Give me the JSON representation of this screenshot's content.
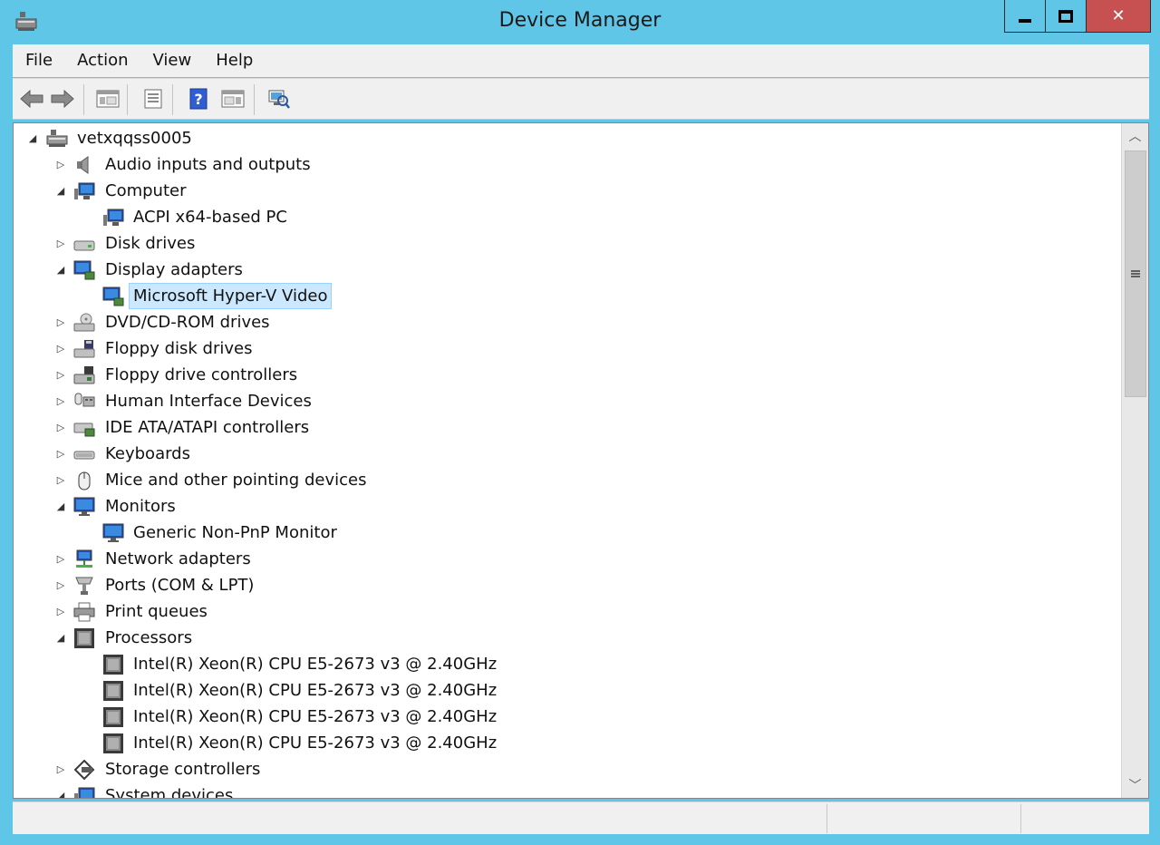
{
  "window": {
    "title": "Device Manager",
    "controls": {
      "minimize": "minimize",
      "maximize": "maximize",
      "close": "✕"
    }
  },
  "menu": [
    "File",
    "Action",
    "View",
    "Help"
  ],
  "toolbar": [
    {
      "name": "back-button",
      "icon": "back-arrow-icon"
    },
    {
      "name": "forward-button",
      "icon": "forward-arrow-icon"
    },
    {
      "name": "show-hide-console-tree-button",
      "icon": "console-tree-icon"
    },
    {
      "name": "properties-button",
      "icon": "properties-icon"
    },
    {
      "name": "help-button",
      "icon": "help-icon"
    },
    {
      "name": "show-action-pane-button",
      "icon": "action-pane-icon"
    },
    {
      "name": "scan-hardware-changes-button",
      "icon": "scan-hardware-icon"
    }
  ],
  "tree": {
    "root": "vetxqqss0005",
    "nodes": [
      {
        "label": "Audio inputs and outputs",
        "expanded": false,
        "icon": "speaker-icon"
      },
      {
        "label": "Computer",
        "expanded": true,
        "icon": "computer-icon",
        "children": [
          "ACPI x64-based PC"
        ]
      },
      {
        "label": "Disk drives",
        "expanded": false,
        "icon": "disk-drive-icon"
      },
      {
        "label": "Display adapters",
        "expanded": true,
        "icon": "display-adapter-icon",
        "children": [
          "Microsoft Hyper-V Video"
        ]
      },
      {
        "label": "DVD/CD-ROM drives",
        "expanded": false,
        "icon": "dvd-drive-icon"
      },
      {
        "label": "Floppy disk drives",
        "expanded": false,
        "icon": "floppy-drive-icon"
      },
      {
        "label": "Floppy drive controllers",
        "expanded": false,
        "icon": "floppy-controller-icon"
      },
      {
        "label": "Human Interface Devices",
        "expanded": false,
        "icon": "hid-icon"
      },
      {
        "label": "IDE ATA/ATAPI controllers",
        "expanded": false,
        "icon": "ide-controller-icon"
      },
      {
        "label": "Keyboards",
        "expanded": false,
        "icon": "keyboard-icon"
      },
      {
        "label": "Mice and other pointing devices",
        "expanded": false,
        "icon": "mouse-icon"
      },
      {
        "label": "Monitors",
        "expanded": true,
        "icon": "monitor-icon",
        "children": [
          "Generic Non-PnP Monitor"
        ]
      },
      {
        "label": "Network adapters",
        "expanded": false,
        "icon": "network-adapter-icon"
      },
      {
        "label": "Ports (COM & LPT)",
        "expanded": false,
        "icon": "port-icon"
      },
      {
        "label": "Print queues",
        "expanded": false,
        "icon": "printer-icon"
      },
      {
        "label": "Processors",
        "expanded": true,
        "icon": "processor-icon",
        "children": [
          "Intel(R) Xeon(R) CPU E5-2673 v3 @ 2.40GHz",
          "Intel(R) Xeon(R) CPU E5-2673 v3 @ 2.40GHz",
          "Intel(R) Xeon(R) CPU E5-2673 v3 @ 2.40GHz",
          "Intel(R) Xeon(R) CPU E5-2673 v3 @ 2.40GHz"
        ]
      },
      {
        "label": "Storage controllers",
        "expanded": false,
        "icon": "storage-controller-icon"
      },
      {
        "label": "System devices",
        "expanded": true,
        "icon": "system-devices-icon"
      }
    ],
    "selected": "Microsoft Hyper-V Video"
  },
  "statusbar": {
    "panes": [
      "",
      "",
      ""
    ]
  },
  "colors": {
    "frame": "#5fc6e8",
    "close": "#c75050",
    "selection": "#cce8ff",
    "selectionBorder": "#99d1ff",
    "panel": "#f0f0f0"
  }
}
